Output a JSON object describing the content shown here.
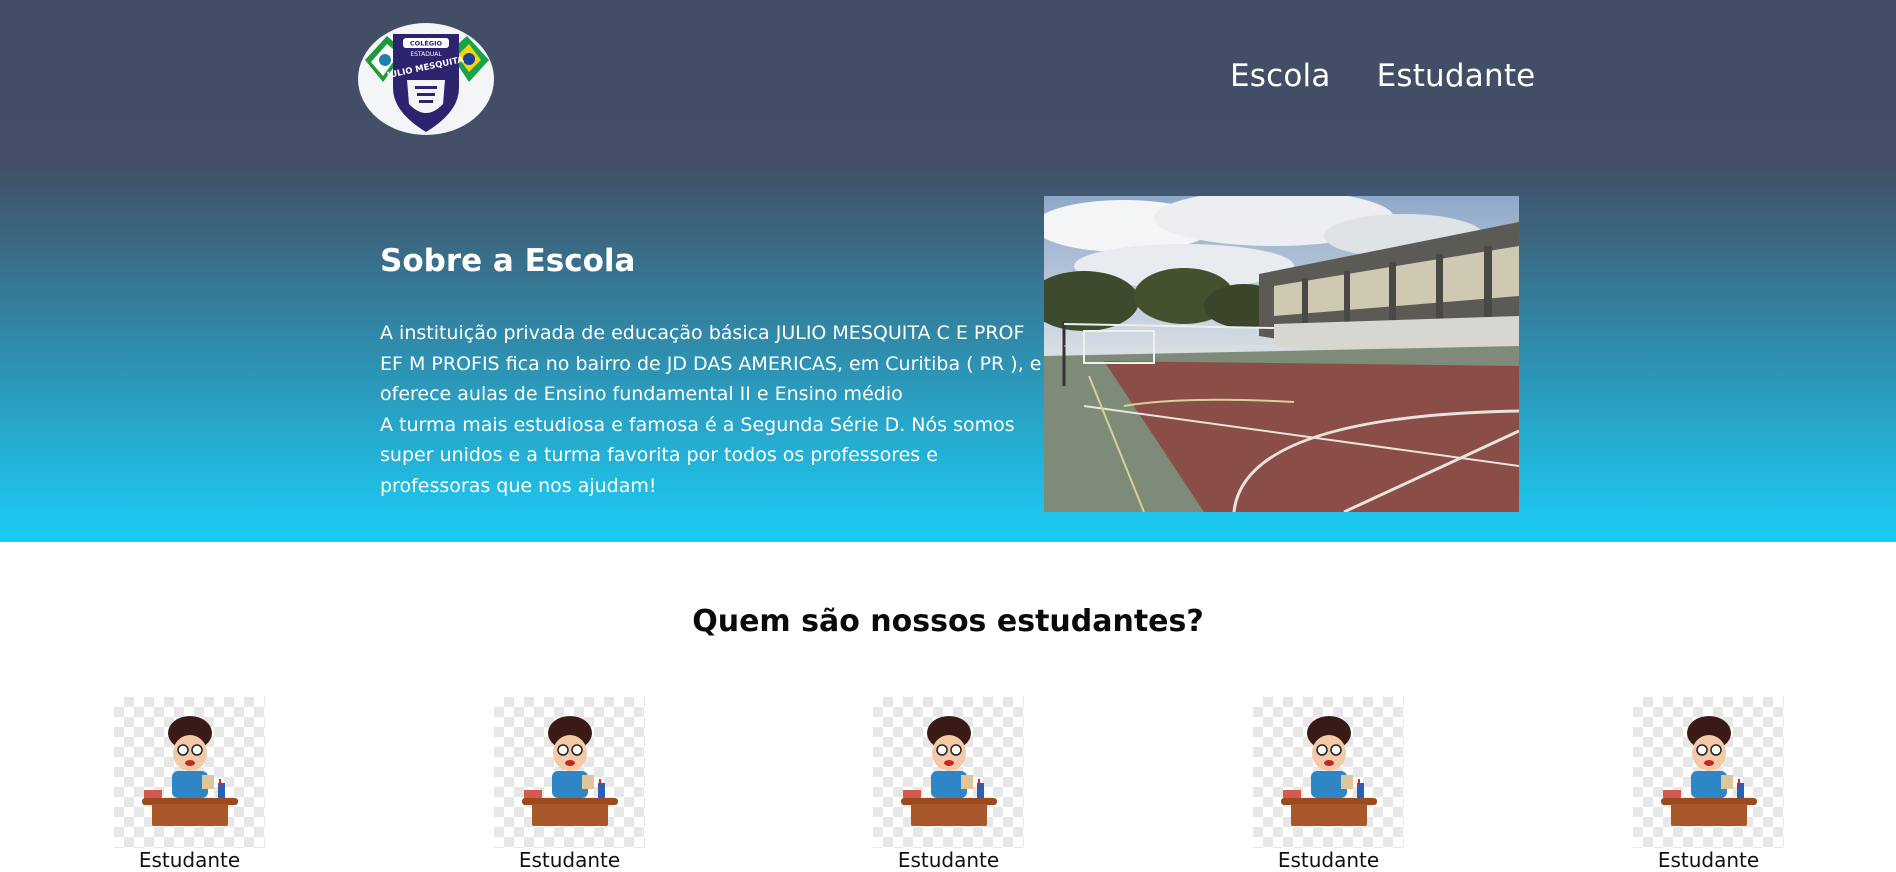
{
  "header": {
    "logo": {
      "line1": "COLÉGIO",
      "line2": "ESTADUAL",
      "name": "JULIO MESQUITA"
    },
    "nav": [
      {
        "label": "Escola"
      },
      {
        "label": "Estudante"
      }
    ]
  },
  "about": {
    "title": "Sobre a Escola",
    "paragraph1": "A instituição privada de educação básica JULIO MESQUITA C E PROF EF M PROFIS fica no bairro de JD DAS AMERICAS, em Curitiba ( PR ), e oferece aulas de Ensino fundamental II e Ensino médio",
    "paragraph2": "A turma mais estudiosa e famosa é a Segunda Série D. Nós somos super unidos e a turma favorita por todos os professores e professoras que nos ajudam!"
  },
  "students": {
    "title": "Quem são nossos estudantes?",
    "cards": [
      {
        "name": "Estudante"
      },
      {
        "name": "Estudante"
      },
      {
        "name": "Estudante"
      },
      {
        "name": "Estudante"
      },
      {
        "name": "Estudante"
      }
    ]
  },
  "colors": {
    "header_dark": "#434f66",
    "hero_cyan": "#18cdf4",
    "logo_shield": "#2d2470"
  },
  "icons": [
    "school-logo",
    "student-illustration"
  ]
}
